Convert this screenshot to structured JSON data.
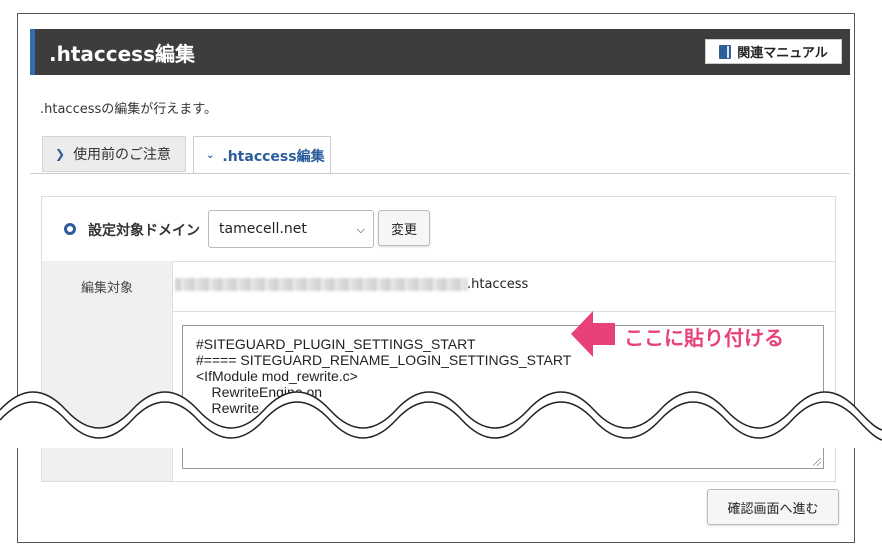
{
  "header": {
    "title": ".htaccess編集",
    "manual_button": "関連マニュアル",
    "accent": "#2f6fb0"
  },
  "description": ".htaccessの編集が行えます。",
  "tabs": [
    {
      "label": "使用前のご注意",
      "icon": "chevron-right-icon",
      "active": false
    },
    {
      "label": ".htaccess編集",
      "icon": "chevron-down-icon",
      "active": true
    }
  ],
  "domain": {
    "label": "設定対象ドメイン",
    "selected": "tamecell.net",
    "change_button": "変更"
  },
  "target": {
    "label": "編集対象",
    "file_suffix": ".htaccess"
  },
  "editor": {
    "lines": [
      "#SITEGUARD_PLUGIN_SETTINGS_START",
      "#==== SITEGUARD_RENAME_LOGIN_SETTINGS_START",
      "<IfModule mod_rewrite.c>",
      "    RewriteEngine on",
      "    Rewrite"
    ]
  },
  "annotation": {
    "text": "ここに貼り付ける",
    "color": "#e8417a"
  },
  "confirm_button": "確認画面へ進む"
}
